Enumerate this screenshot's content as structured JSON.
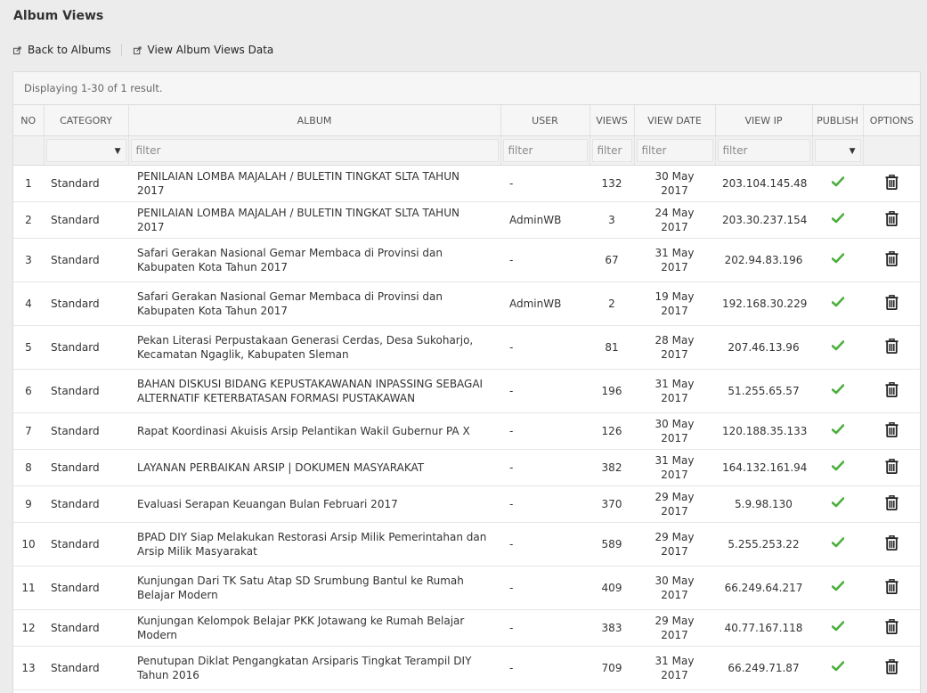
{
  "page": {
    "title": "Album Views"
  },
  "toolbar": {
    "back_label": "Back to Albums",
    "view_data_label": "View Album Views Data"
  },
  "summary": "Displaying 1-30 of 1 result.",
  "columns": {
    "no": "NO",
    "category": "CATEGORY",
    "album": "ALBUM",
    "user": "USER",
    "views": "VIEWS",
    "view_date": "VIEW DATE",
    "view_ip": "VIEW IP",
    "publish": "PUBLISH",
    "options": "OPTIONS"
  },
  "filters": {
    "album": "filter",
    "user": "filter",
    "views": "filter",
    "view_date": "filter",
    "view_ip": "filter"
  },
  "colors": {
    "check": "#4caf3d",
    "trash": "#222222"
  },
  "icons": {
    "publish": "check-icon",
    "delete": "trash-icon",
    "link": "external-link-icon",
    "dropdown": "caret-down-icon"
  },
  "rows": [
    {
      "no": "1",
      "category": "Standard",
      "album": "PENILAIAN LOMBA MAJALAH / BULETIN TINGKAT SLTA TAHUN 2017",
      "user": "-",
      "views": "132",
      "date": "30 May 2017",
      "ip": "203.104.145.48",
      "published": true
    },
    {
      "no": "2",
      "category": "Standard",
      "album": "PENILAIAN LOMBA MAJALAH / BULETIN TINGKAT SLTA TAHUN 2017",
      "user": "AdminWB",
      "views": "3",
      "date": "24 May 2017",
      "ip": "203.30.237.154",
      "published": true
    },
    {
      "no": "3",
      "category": "Standard",
      "album": "Safari Gerakan Nasional Gemar Membaca di Provinsi dan Kabupaten Kota Tahun 2017",
      "user": "-",
      "views": "67",
      "date": "31 May 2017",
      "ip": "202.94.83.196",
      "published": true
    },
    {
      "no": "4",
      "category": "Standard",
      "album": "Safari Gerakan Nasional Gemar Membaca di Provinsi dan Kabupaten Kota Tahun 2017",
      "user": "AdminWB",
      "views": "2",
      "date": "19 May 2017",
      "ip": "192.168.30.229",
      "published": true
    },
    {
      "no": "5",
      "category": "Standard",
      "album": "Pekan Literasi Perpustakaan Generasi Cerdas, Desa Sukoharjo, Kecamatan Ngaglik, Kabupaten Sleman",
      "user": "-",
      "views": "81",
      "date": "28 May 2017",
      "ip": "207.46.13.96",
      "published": true
    },
    {
      "no": "6",
      "category": "Standard",
      "album": "BAHAN DISKUSI BIDANG KEPUSTAKAWANAN INPASSING SEBAGAI ALTERNATIF KETERBATASAN FORMASI PUSTAKAWAN",
      "user": "-",
      "views": "196",
      "date": "31 May 2017",
      "ip": "51.255.65.57",
      "published": true
    },
    {
      "no": "7",
      "category": "Standard",
      "album": "Rapat Koordinasi Akuisis Arsip Pelantikan Wakil Gubernur PA X",
      "user": "-",
      "views": "126",
      "date": "30 May 2017",
      "ip": "120.188.35.133",
      "published": true
    },
    {
      "no": "8",
      "category": "Standard",
      "album": "LAYANAN PERBAIKAN ARSIP | DOKUMEN MASYARAKAT",
      "user": "-",
      "views": "382",
      "date": "31 May 2017",
      "ip": "164.132.161.94",
      "published": true
    },
    {
      "no": "9",
      "category": "Standard",
      "album": "Evaluasi Serapan Keuangan Bulan Februari 2017",
      "user": "-",
      "views": "370",
      "date": "29 May 2017",
      "ip": "5.9.98.130",
      "published": true
    },
    {
      "no": "10",
      "category": "Standard",
      "album": "BPAD DIY Siap Melakukan Restorasi Arsip Milik Pemerintahan dan Arsip Milik Masyarakat",
      "user": "-",
      "views": "589",
      "date": "29 May 2017",
      "ip": "5.255.253.22",
      "published": true
    },
    {
      "no": "11",
      "category": "Standard",
      "album": "Kunjungan Dari TK Satu Atap SD Srumbung Bantul ke Rumah Belajar Modern",
      "user": "-",
      "views": "409",
      "date": "30 May 2017",
      "ip": "66.249.64.217",
      "published": true
    },
    {
      "no": "12",
      "category": "Standard",
      "album": "Kunjungan Kelompok Belajar PKK Jotawang ke Rumah Belajar Modern",
      "user": "-",
      "views": "383",
      "date": "29 May 2017",
      "ip": "40.77.167.118",
      "published": true
    },
    {
      "no": "13",
      "category": "Standard",
      "album": "Penutupan Diklat Pengangkatan Arsiparis Tingkat Terampil DIY Tahun 2016",
      "user": "-",
      "views": "709",
      "date": "31 May 2017",
      "ip": "66.249.71.87",
      "published": true
    }
  ]
}
